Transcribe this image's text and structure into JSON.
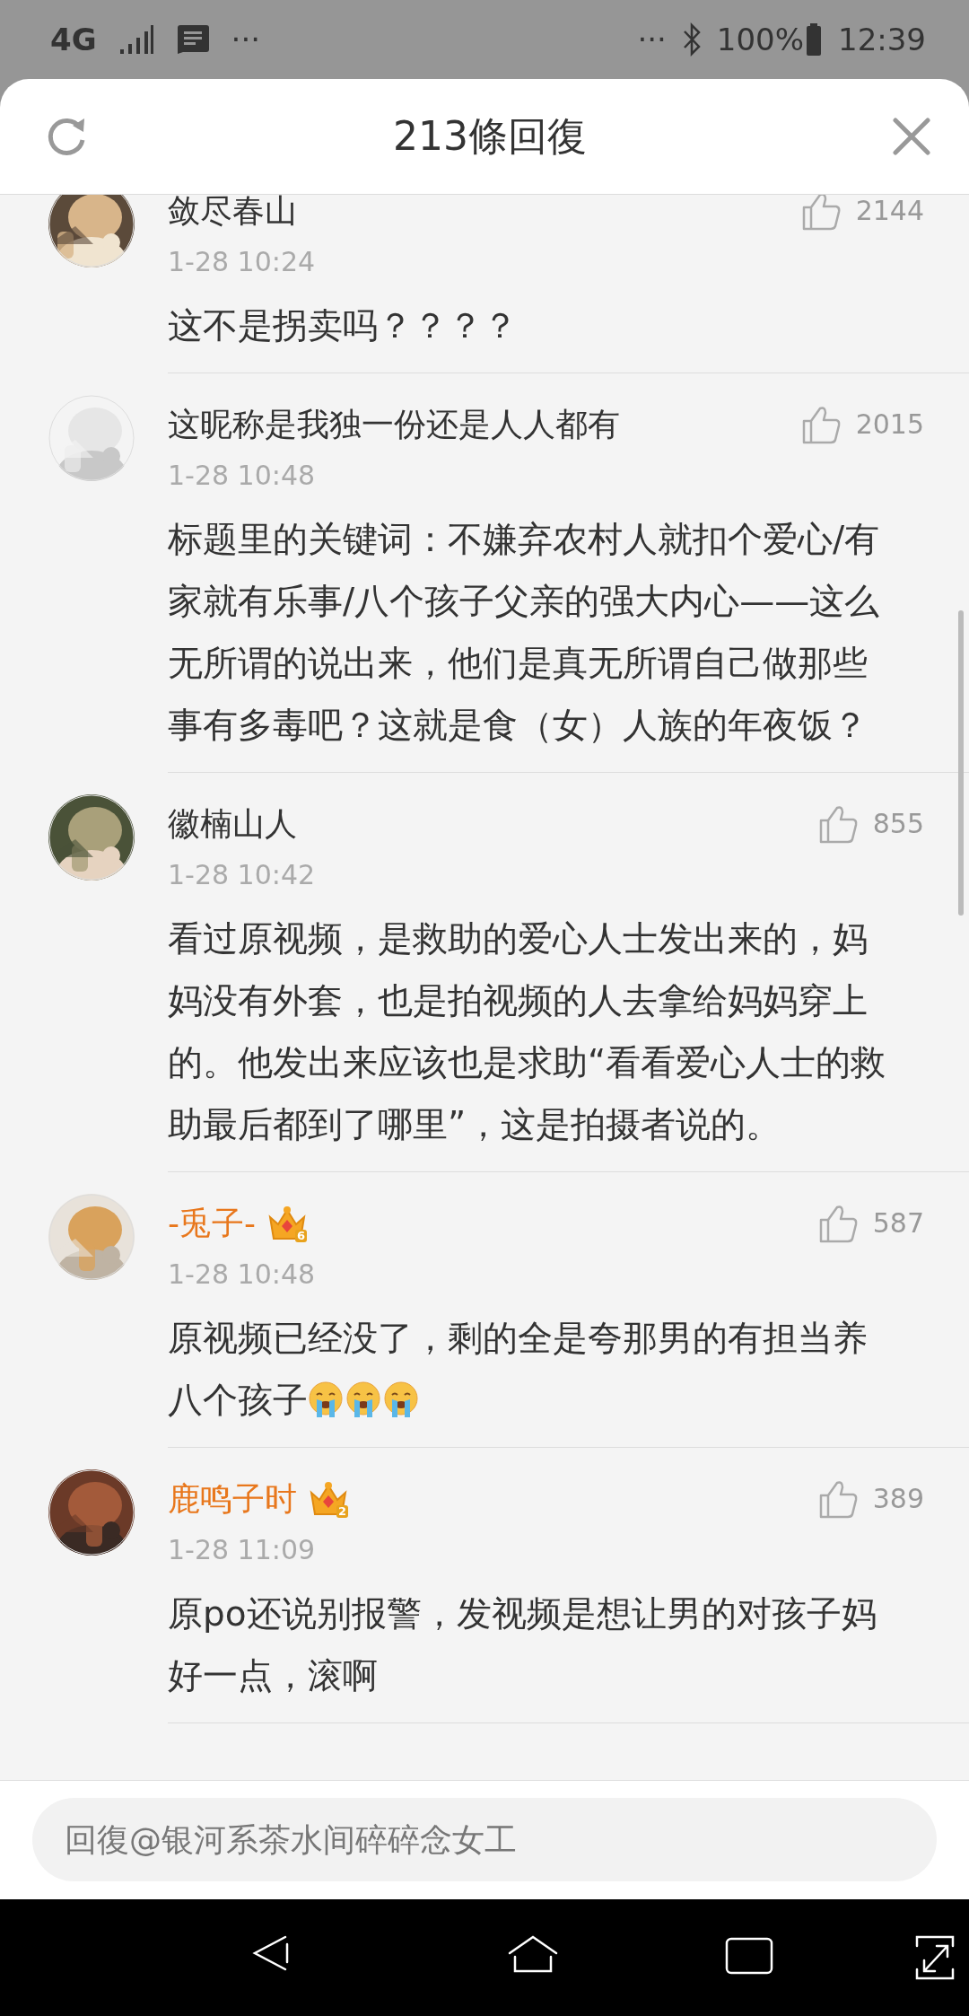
{
  "status_bar": {
    "network": "4G",
    "more_left": "···",
    "more_right": "···",
    "battery": "100%",
    "time": "12:39"
  },
  "header": {
    "title": "213條回復"
  },
  "comments": [
    {
      "name": "敛尽春山",
      "member": false,
      "time": "1-28 10:24",
      "likes": "2144",
      "body": [
        {
          "kind": "text",
          "text": "这不是拐卖吗？？？？"
        }
      ]
    },
    {
      "name": "这昵称是我独一份还是人人都有",
      "member": false,
      "time": "1-28 10:48",
      "likes": "2015",
      "body": [
        {
          "kind": "text",
          "text": "标题里的关键词：不嫌弃农村人就扣个爱心/有家就有乐事/八个孩子父亲的强大内心——这么无所谓的说出来，他们是真无所谓自己做那些事有多毒吧？这就是食（女）人族的年夜饭？"
        }
      ]
    },
    {
      "name": "徽楠山人",
      "member": false,
      "time": "1-28 10:42",
      "likes": "855",
      "body": [
        {
          "kind": "text",
          "text": "看过原视频，是救助的爱心人士发出来的，妈妈没有外套，也是拍视频的人去拿给妈妈穿上的。他发出来应该也是求助“看看爱心人士的救助最后都到了哪里”，这是拍摄者说的。"
        }
      ]
    },
    {
      "name": "-兎子-",
      "member": true,
      "vip_level": "6",
      "time": "1-28 10:48",
      "likes": "587",
      "body": [
        {
          "kind": "text",
          "text": "原视频已经没了，剩的全是夸那男的有担当养八个孩子"
        },
        {
          "kind": "emoji"
        },
        {
          "kind": "emoji"
        },
        {
          "kind": "emoji"
        }
      ]
    },
    {
      "name": "鹿鸣子时",
      "member": true,
      "vip_level": "2",
      "time": "1-28 11:09",
      "likes": "389",
      "body": [
        {
          "kind": "text",
          "text": "原po还说别报警，发视频是想让男的对孩子妈好一点，滚啊"
        }
      ]
    }
  ],
  "reply_box": {
    "placeholder": "回復@银河系茶水间碎碎念女工"
  }
}
